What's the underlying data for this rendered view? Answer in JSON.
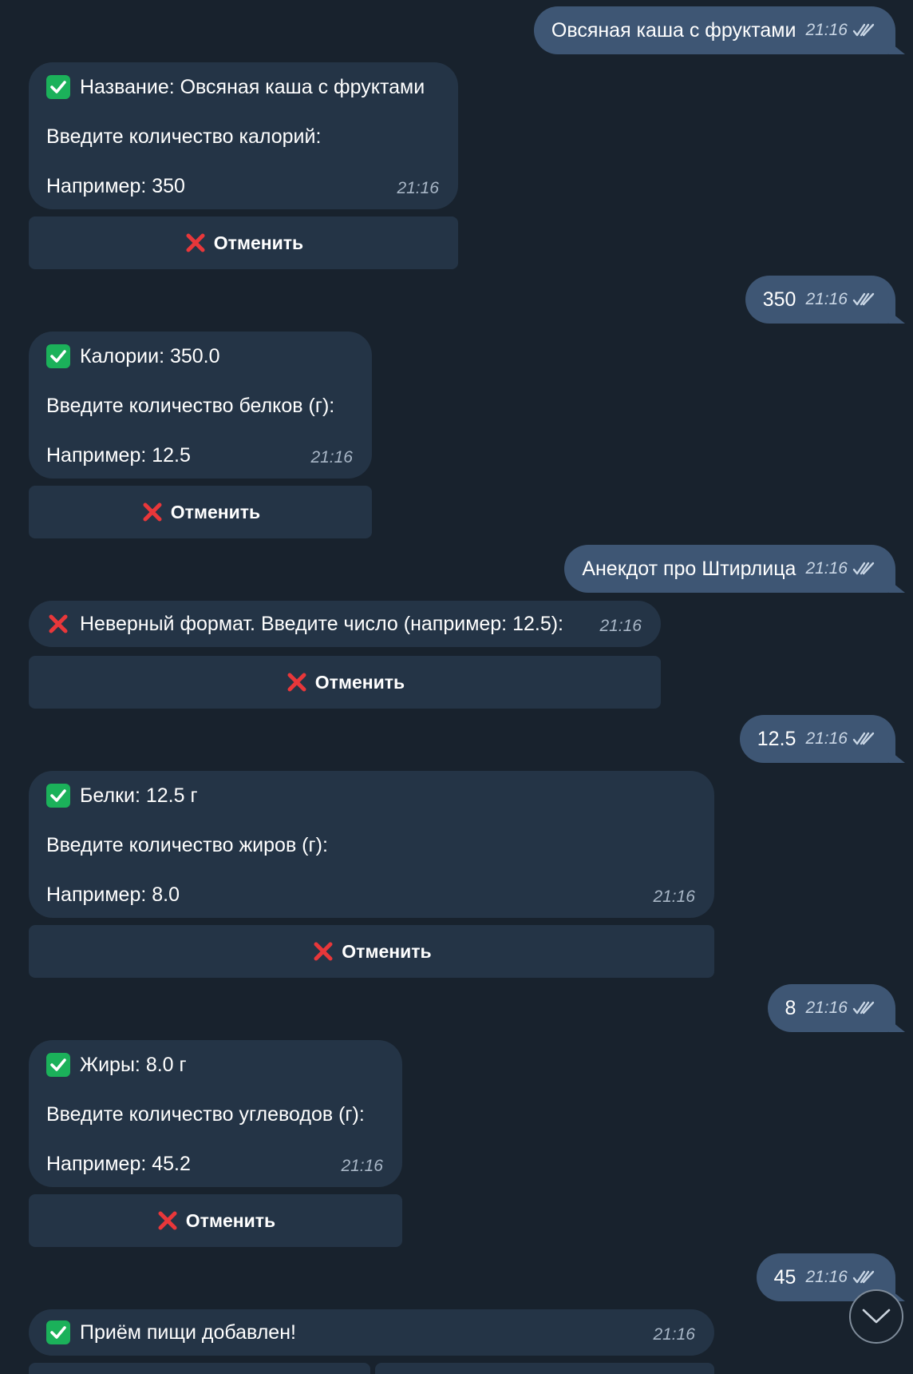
{
  "colors": {
    "background": "#18222d",
    "incoming": "#243446",
    "outgoing": "#3e5674",
    "accent_check": "#1bb15a",
    "accent_x": "#e8373a"
  },
  "messages": {
    "m1": {
      "text": "Овсяная каша с фруктами",
      "time": "21:16",
      "status": "read-double-check-icon"
    },
    "m2": {
      "line1": "Название: Овсяная каша с фруктами",
      "line2": "Введите количество калорий:",
      "line3": "Например: 350",
      "time": "21:16",
      "button": "Отменить"
    },
    "m3": {
      "text": "350",
      "time": "21:16"
    },
    "m4": {
      "line1": "Калории: 350.0",
      "line2": "Введите количество белков (г):",
      "line3": "Например: 12.5",
      "time": "21:16",
      "button": "Отменить"
    },
    "m5": {
      "text": "Анекдот про Штирлица",
      "time": "21:16"
    },
    "m6": {
      "line1": "Неверный формат. Введите число (например: 12.5):",
      "time": "21:16",
      "button": "Отменить"
    },
    "m7": {
      "text": "12.5",
      "time": "21:16"
    },
    "m8": {
      "line1": "Белки: 12.5 г",
      "line2": "Введите количество жиров (г):",
      "line3": "Например: 8.0",
      "time": "21:16",
      "button": "Отменить"
    },
    "m9": {
      "text": "8",
      "time": "21:16"
    },
    "m10": {
      "line1": "Жиры: 8.0 г",
      "line2": "Введите количество углеводов (г):",
      "line3": "Например: 45.2",
      "time": "21:16",
      "button": "Отменить"
    },
    "m11": {
      "text": "45",
      "time": "21:16"
    },
    "m12": {
      "line1": "Приём пищи добавлен!",
      "time": "21:16"
    }
  },
  "icons": {
    "check": "check-mark-emoji-icon",
    "cross": "cross-mark-emoji-icon",
    "read": "double-check-icon",
    "scroll": "chevron-down-icon"
  }
}
